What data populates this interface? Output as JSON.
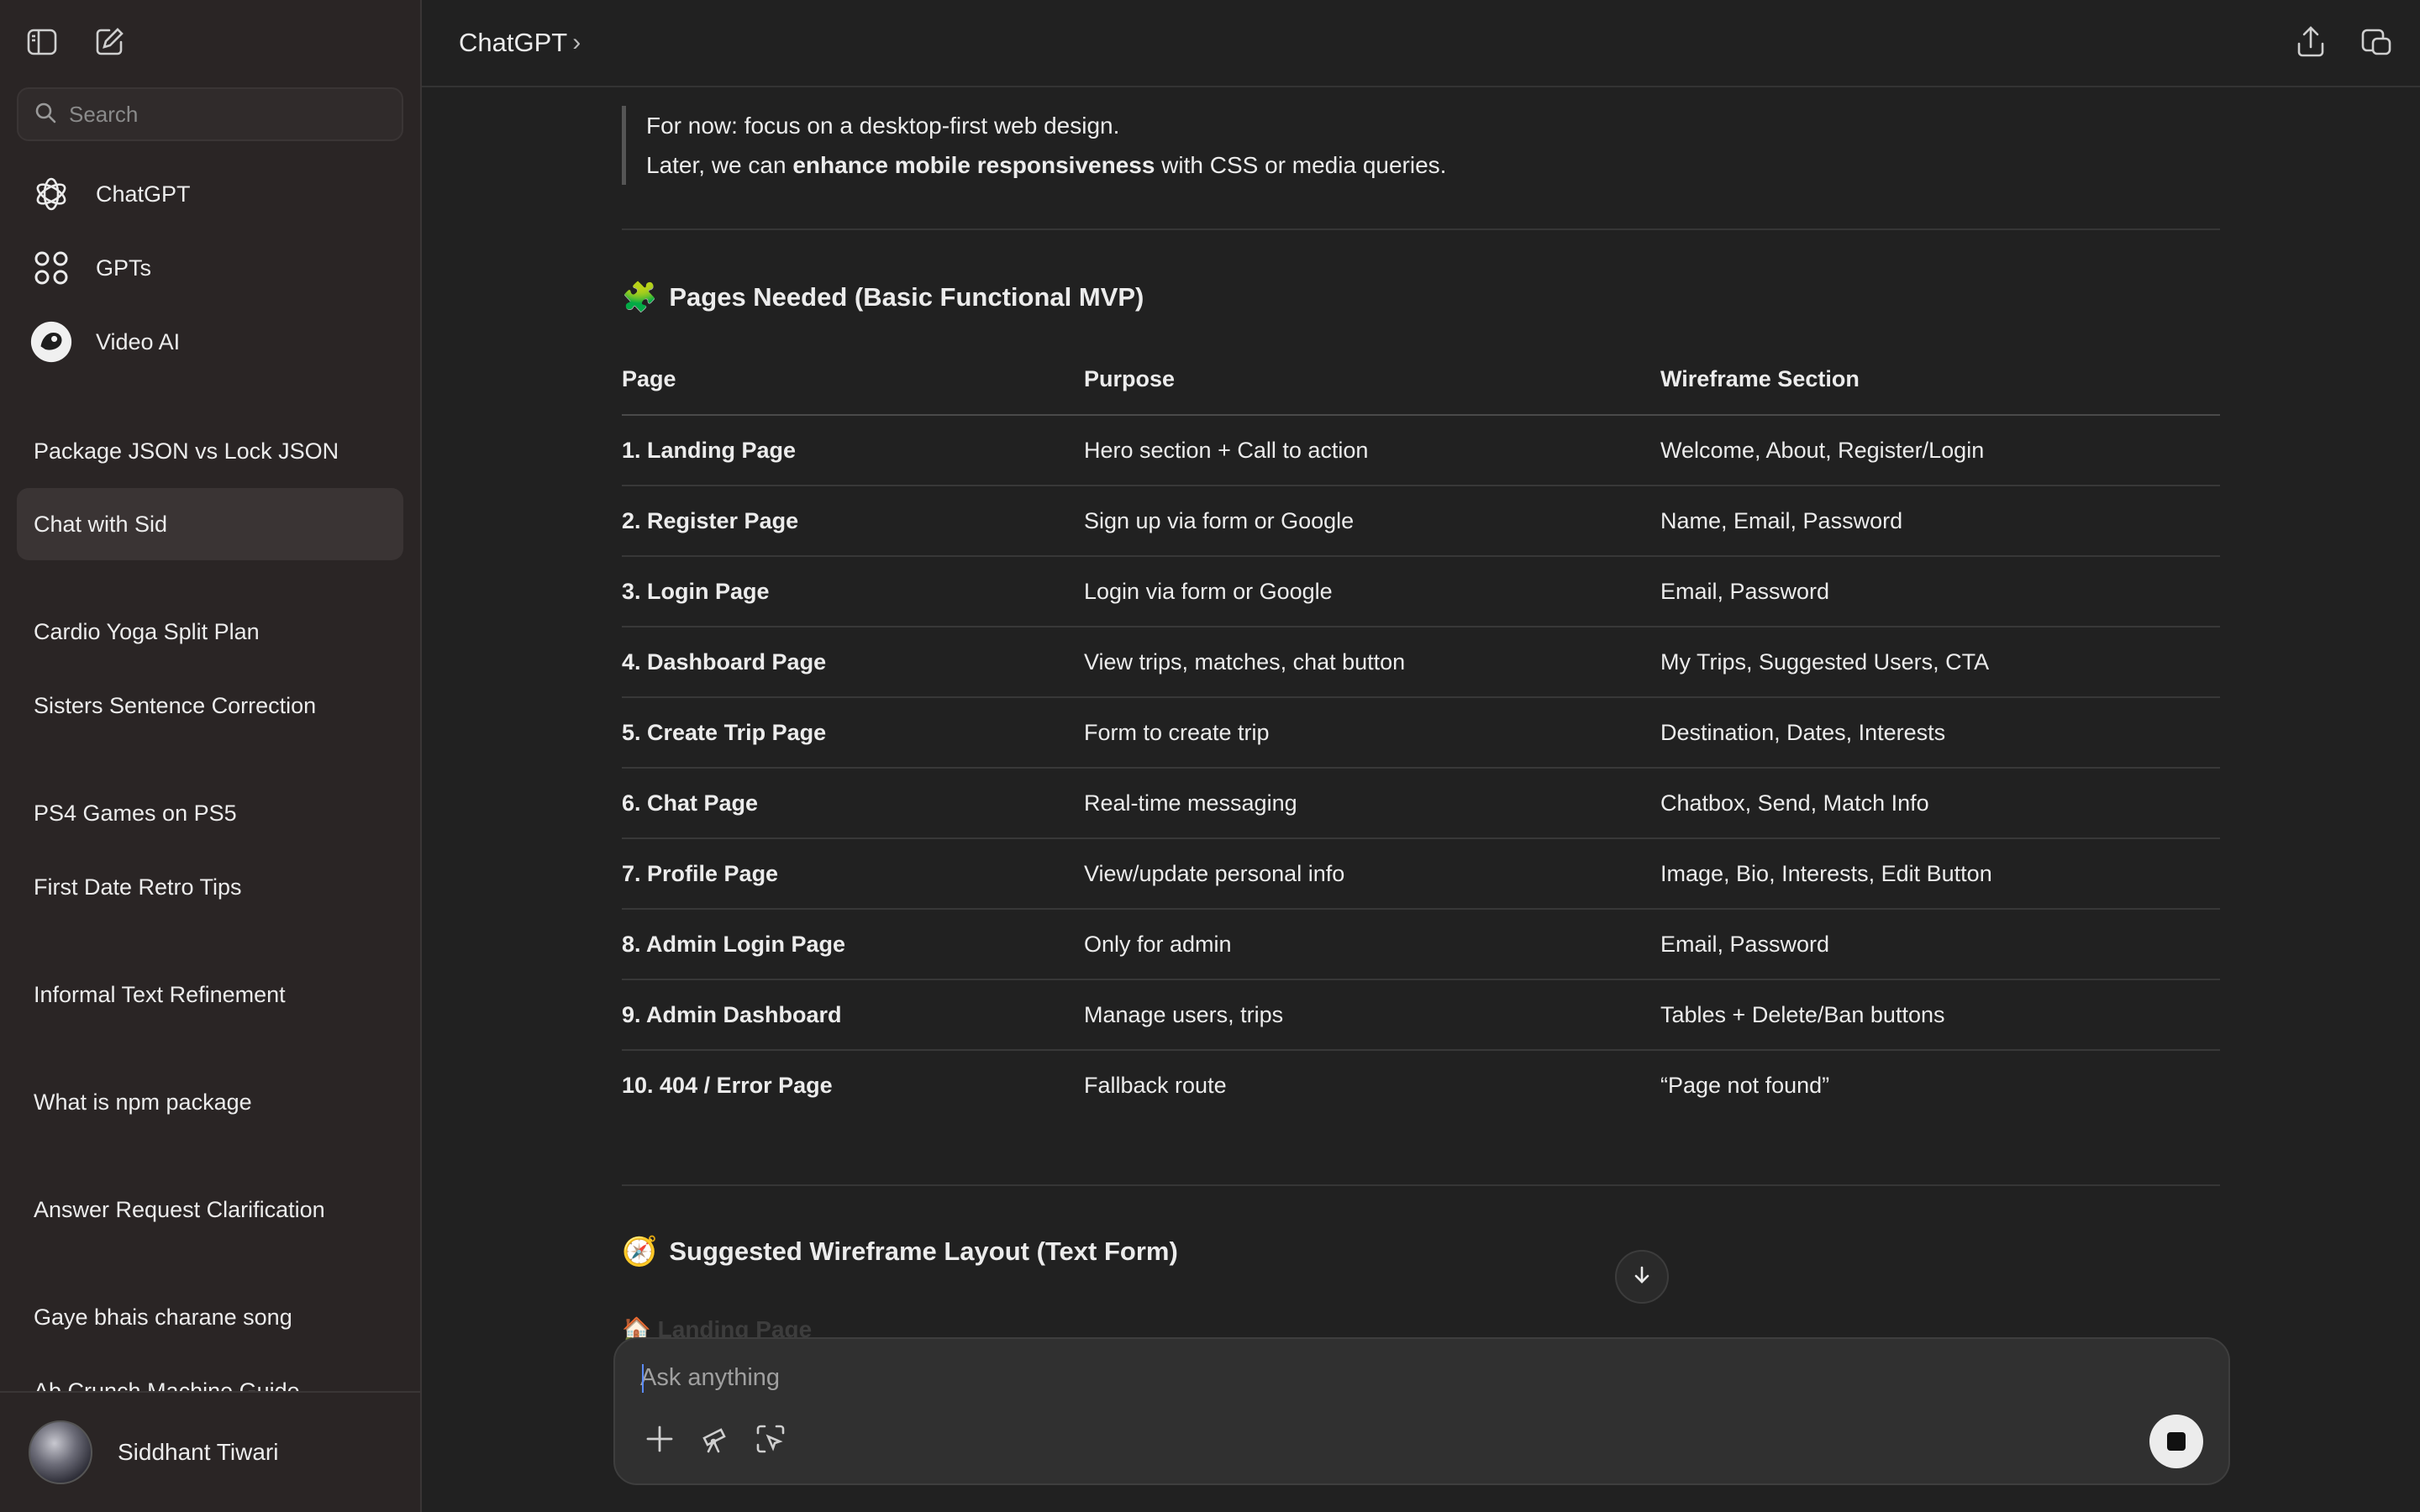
{
  "sidebar": {
    "search_placeholder": "Search",
    "nav": [
      {
        "label": "ChatGPT",
        "icon": "openai-logo-icon"
      },
      {
        "label": "GPTs",
        "icon": "grid-icon"
      },
      {
        "label": "Video AI",
        "icon": "video-ai-icon"
      }
    ],
    "chats": [
      "Package JSON vs Lock JSON",
      "Chat with Sid",
      "Cardio Yoga Split Plan",
      "Sisters Sentence Correction",
      "PS4 Games on PS5",
      "First Date Retro Tips",
      "Informal Text Refinement",
      "What is npm package",
      "Answer Request Clarification",
      "Gaye bhais charane song",
      "Ab Crunch Machine Guide"
    ],
    "active_chat_index": 1,
    "user_name": "Siddhant Tiwari"
  },
  "header": {
    "title": "ChatGPT",
    "chevron": "›"
  },
  "content": {
    "quote_line1": "For now: focus on a desktop-first web design.",
    "quote_line2_pre": "Later, we can ",
    "quote_line2_bold": "enhance mobile responsiveness",
    "quote_line2_post": " with CSS or media queries.",
    "section1_emoji": "🧩",
    "section1_title": "Pages Needed (Basic Functional MVP)",
    "table": {
      "headers": [
        "Page",
        "Purpose",
        "Wireframe Section"
      ],
      "rows": [
        [
          "1. Landing Page",
          "Hero section + Call to action",
          "Welcome, About, Register/Login"
        ],
        [
          "2. Register Page",
          "Sign up via form or Google",
          "Name, Email, Password"
        ],
        [
          "3. Login Page",
          "Login via form or Google",
          "Email, Password"
        ],
        [
          "4. Dashboard Page",
          "View trips, matches, chat button",
          "My Trips, Suggested Users, CTA"
        ],
        [
          "5. Create Trip Page",
          "Form to create trip",
          "Destination, Dates, Interests"
        ],
        [
          "6. Chat Page",
          "Real-time messaging",
          "Chatbox, Send, Match Info"
        ],
        [
          "7. Profile Page",
          "View/update personal info",
          "Image, Bio, Interests, Edit Button"
        ],
        [
          "8. Admin Login Page",
          "Only for admin",
          "Email, Password"
        ],
        [
          "9. Admin Dashboard",
          "Manage users, trips",
          "Tables + Delete/Ban buttons"
        ],
        [
          "10. 404 / Error Page",
          "Fallback route",
          "“Page not found”"
        ]
      ]
    },
    "section2_emoji": "🧭",
    "section2_title": "Suggested Wireframe Layout (Text Form)",
    "faded_next": "🏠 Landing Page"
  },
  "composer": {
    "placeholder": "Ask anything"
  }
}
